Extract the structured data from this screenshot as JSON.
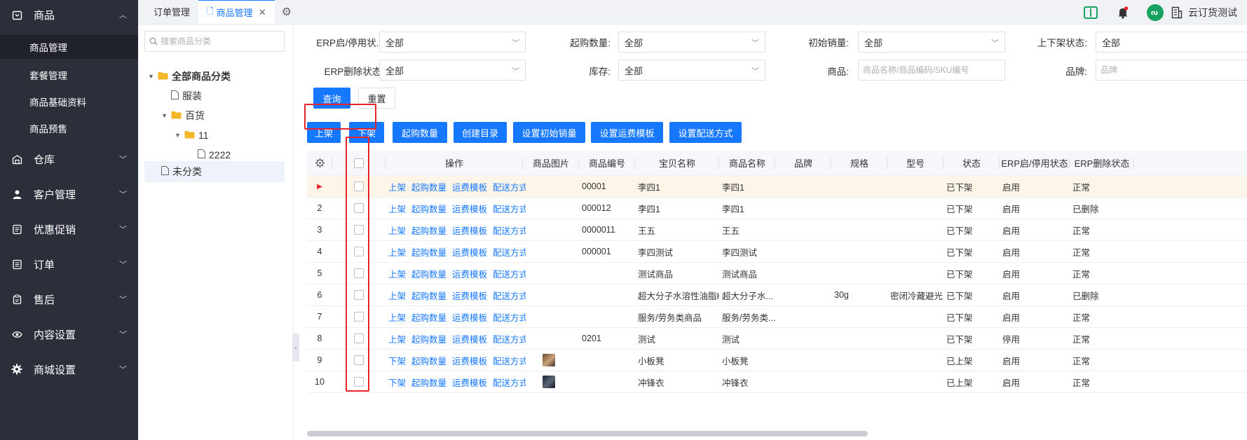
{
  "sidebar": {
    "groups": [
      {
        "label": "商品",
        "icon": "product-box-icon"
      },
      {
        "label": "仓库",
        "icon": "warehouse-icon"
      },
      {
        "label": "客户管理",
        "icon": "user-icon"
      },
      {
        "label": "优惠促销",
        "icon": "promotion-icon"
      },
      {
        "label": "订单",
        "icon": "order-icon"
      },
      {
        "label": "售后",
        "icon": "after-sale-icon"
      },
      {
        "label": "内容设置",
        "icon": "eye-icon"
      },
      {
        "label": "商城设置",
        "icon": "gear-icon"
      }
    ],
    "product_sub": [
      "商品管理",
      "套餐管理",
      "商品基础资料",
      "商品预售"
    ]
  },
  "topbar": {
    "tabs": [
      "订单管理",
      "商品管理"
    ],
    "active_tab": "商品管理",
    "shop_name": "云订货测试"
  },
  "category_panel": {
    "search_placeholder": "搜索商品分类",
    "nodes": {
      "root": "全部商品分类",
      "clothing": "服装",
      "general": "百货",
      "n11": "11",
      "n2222": "2222",
      "uncategorized": "未分类"
    }
  },
  "filters": {
    "erp_status_label": "ERP启/停用状...",
    "erp_status_value": "全部",
    "min_qty_label": "起购数量:",
    "min_qty_value": "全部",
    "init_sales_label": "初始销量:",
    "init_sales_value": "全部",
    "shelf_status_label": "上下架状态:",
    "shelf_status_value": "全部",
    "erp_delete_label": "ERP删除状态:",
    "erp_delete_value": "全部",
    "stock_label": "库存:",
    "stock_value": "全部",
    "product_label": "商品:",
    "product_placeholder": "商品名称/商品编码/SKU编号",
    "brand_label": "品牌:",
    "brand_placeholder": "品牌",
    "query_button": "查询",
    "reset_button": "重置"
  },
  "toolbar": {
    "on_shelf": "上架",
    "off_shelf": "下架",
    "min_qty": "起购数量",
    "create_catalog": "创建目录",
    "set_init_sales": "设置初始销量",
    "set_shipping_template": "设置运费模板",
    "set_delivery": "设置配送方式"
  },
  "table": {
    "headers": {
      "op": "操作",
      "image": "商品图片",
      "code": "商品编号",
      "baby_name": "宝贝名称",
      "name": "商品名称",
      "brand": "品牌",
      "spec": "规格",
      "model": "型号",
      "status": "状态",
      "erp_status": "ERP启/停用状态",
      "erp_delete": "ERP删除状态"
    },
    "op_labels": {
      "qty": "起购数量",
      "tpl": "运费模板",
      "delivery": "配送方式"
    },
    "rows": [
      {
        "idx": "▶",
        "shelf_op": "上架",
        "has_img": false,
        "code": "00001",
        "baby": "李四1",
        "name": "李四1",
        "brand": "",
        "spec": "",
        "model": "",
        "status": "已下架",
        "erp": "启用",
        "del": "正常"
      },
      {
        "idx": "2",
        "shelf_op": "上架",
        "has_img": false,
        "code": "000012",
        "baby": "李四1",
        "name": "李四1",
        "brand": "",
        "spec": "",
        "model": "",
        "status": "已下架",
        "erp": "启用",
        "del": "已删除"
      },
      {
        "idx": "3",
        "shelf_op": "上架",
        "has_img": false,
        "code": "0000011",
        "baby": "王五",
        "name": "王五",
        "brand": "",
        "spec": "",
        "model": "",
        "status": "已下架",
        "erp": "启用",
        "del": "正常"
      },
      {
        "idx": "4",
        "shelf_op": "上架",
        "has_img": false,
        "code": "000001",
        "baby": "李四测试",
        "name": "李四测试",
        "brand": "",
        "spec": "",
        "model": "",
        "status": "已下架",
        "erp": "启用",
        "del": "正常"
      },
      {
        "idx": "5",
        "shelf_op": "上架",
        "has_img": false,
        "code": "",
        "baby": "测试商品",
        "name": "测试商品",
        "brand": "",
        "spec": "",
        "model": "",
        "status": "已下架",
        "erp": "启用",
        "del": "正常"
      },
      {
        "idx": "6",
        "shelf_op": "上架",
        "has_img": false,
        "code": "",
        "baby": "超大分子水溶性油脂KG",
        "name": "超大分子水...",
        "brand": "",
        "spec": "30g",
        "model": "密闭冷藏避光",
        "status": "已下架",
        "erp": "启用",
        "del": "已删除"
      },
      {
        "idx": "7",
        "shelf_op": "上架",
        "has_img": false,
        "code": "",
        "baby": "服务/劳务类商品",
        "name": "服务/劳务类...",
        "brand": "",
        "spec": "",
        "model": "",
        "status": "已下架",
        "erp": "启用",
        "del": "正常"
      },
      {
        "idx": "8",
        "shelf_op": "上架",
        "has_img": false,
        "code": "0201",
        "baby": "测试",
        "name": "测试",
        "brand": "",
        "spec": "",
        "model": "",
        "status": "已下架",
        "erp": "停用",
        "del": "正常"
      },
      {
        "idx": "9",
        "shelf_op": "下架",
        "has_img": true,
        "code": "",
        "baby": "小板凳",
        "name": "小板凳",
        "brand": "",
        "spec": "",
        "model": "",
        "status": "已上架",
        "erp": "启用",
        "del": "正常"
      },
      {
        "idx": "10",
        "shelf_op": "下架",
        "has_img": true,
        "code": "",
        "baby": "冲锋衣",
        "name": "冲锋衣",
        "brand": "",
        "spec": "",
        "model": "",
        "status": "已上架",
        "erp": "启用",
        "del": "正常"
      }
    ]
  },
  "colors": {
    "primary": "#1677ff",
    "sidebar": "#2b2f3a",
    "highlight": "#e8232b"
  }
}
